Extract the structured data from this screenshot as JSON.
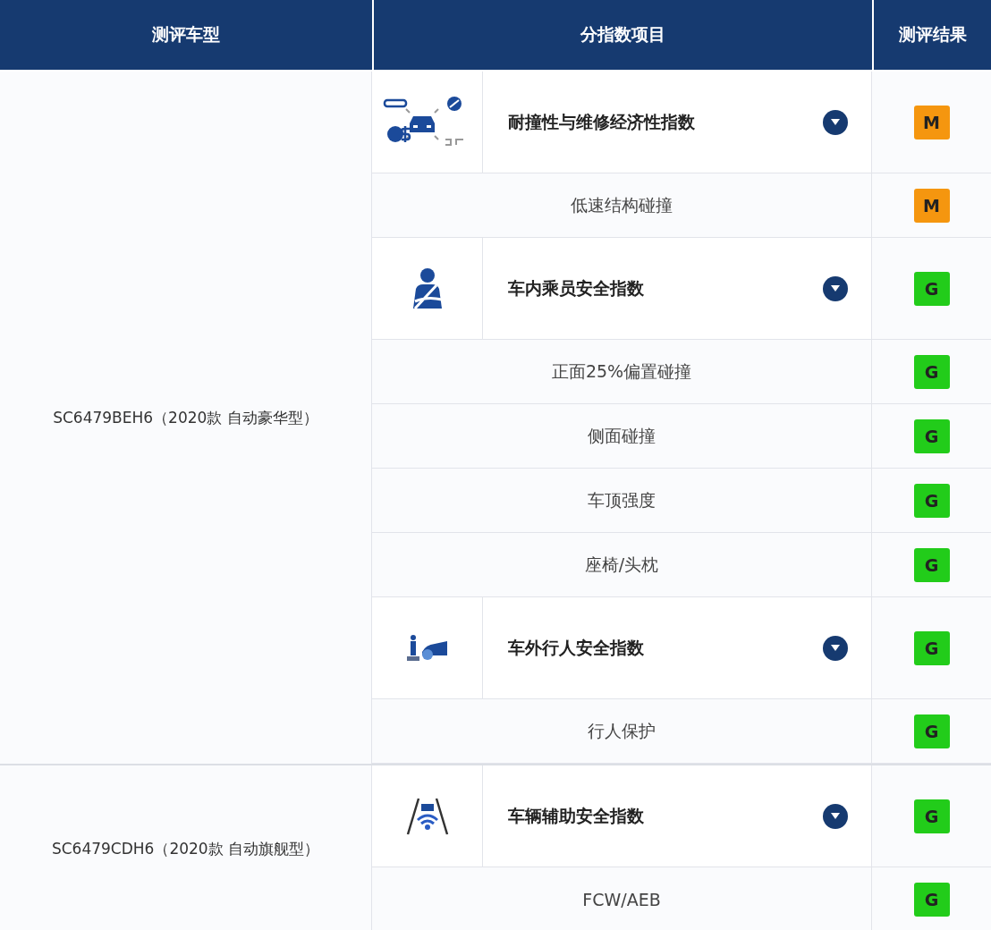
{
  "columns": [
    "测评车型",
    "分指数项目",
    "测评结果"
  ],
  "vehicles": [
    {
      "model": "SC6479BEH6（2020款 自动豪华型）",
      "rows": [
        {
          "kind": "repair",
          "label": "耐撞性与维修经济性指数",
          "rating": "M",
          "color": "#f5960f"
        },
        {
          "kind": "item",
          "label": "低速结构碰撞",
          "rating": "M",
          "color": "#f5960f"
        },
        {
          "kind": "occupant",
          "label": "车内乘员安全指数",
          "rating": "G",
          "color": "#22cc1a"
        },
        {
          "kind": "item",
          "label": "正面25%偏置碰撞",
          "rating": "G",
          "color": "#22cc1a"
        },
        {
          "kind": "item",
          "label": "侧面碰撞",
          "rating": "G",
          "color": "#22cc1a"
        },
        {
          "kind": "item",
          "label": "车顶强度",
          "rating": "G",
          "color": "#22cc1a"
        },
        {
          "kind": "item",
          "label": "座椅/头枕",
          "rating": "G",
          "color": "#22cc1a"
        },
        {
          "kind": "pedestrian",
          "label": "车外行人安全指数",
          "rating": "G",
          "color": "#22cc1a"
        },
        {
          "kind": "item",
          "label": "行人保护",
          "rating": "G",
          "color": "#22cc1a"
        }
      ]
    },
    {
      "model": "SC6479CDH6（2020款 自动旗舰型）",
      "rows": [
        {
          "kind": "assist",
          "label": "车辆辅助安全指数",
          "rating": "G",
          "color": "#22cc1a"
        },
        {
          "kind": "item",
          "label": "FCW/AEB",
          "rating": "G",
          "color": "#22cc1a"
        }
      ]
    }
  ]
}
